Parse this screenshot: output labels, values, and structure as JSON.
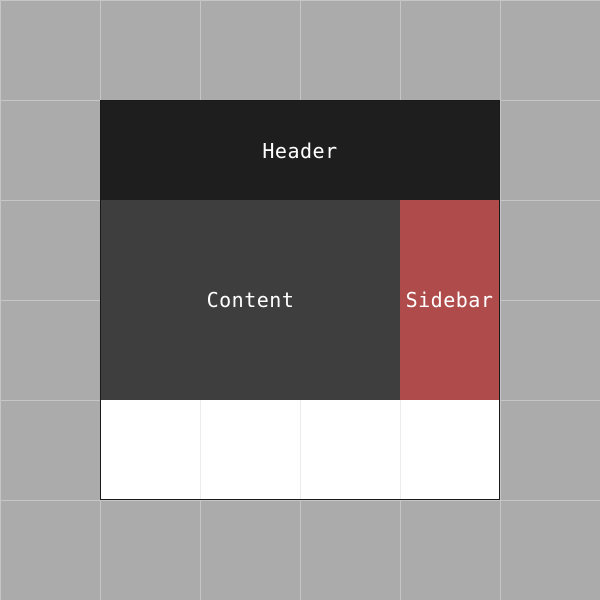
{
  "regions": {
    "header": {
      "label": "Header",
      "color": "#1e1e1e"
    },
    "content": {
      "label": "Content",
      "color": "#3e3e3e"
    },
    "sidebar": {
      "label": "Sidebar",
      "color": "#b04b4b"
    }
  },
  "colors": {
    "canvas": "#ababab",
    "grid_line": "#c6c6c6",
    "layout_background": "#ffffff",
    "layout_border": "#1a1a1a",
    "label_text": "#ffffff"
  }
}
